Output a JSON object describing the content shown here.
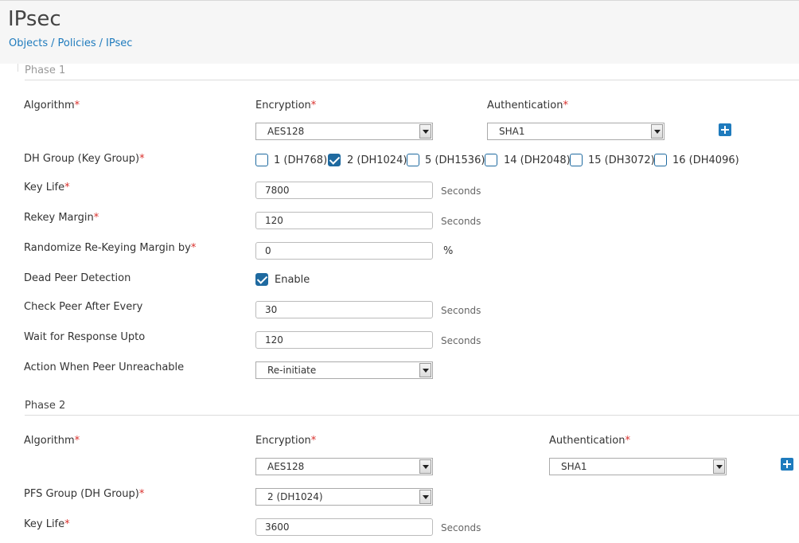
{
  "header": {
    "title": "IPsec",
    "breadcrumb": [
      "Objects",
      "Policies",
      "IPsec"
    ]
  },
  "phase1": {
    "title": "Phase 1",
    "algorithm_label": "Algorithm",
    "encryption_label": "Encryption",
    "authentication_label": "Authentication",
    "encryption_value": "AES128",
    "authentication_value": "SHA1",
    "dh_group_label": "DH Group (Key Group)",
    "dh_groups": [
      {
        "label": "1 (DH768)",
        "checked": false
      },
      {
        "label": "2 (DH1024)",
        "checked": true
      },
      {
        "label": "5 (DH1536)",
        "checked": false
      },
      {
        "label": "14 (DH2048)",
        "checked": false
      },
      {
        "label": "15 (DH3072)",
        "checked": false
      },
      {
        "label": "16 (DH4096)",
        "checked": false
      }
    ],
    "key_life_label": "Key Life",
    "key_life_value": "7800",
    "rekey_margin_label": "Rekey Margin",
    "rekey_margin_value": "120",
    "randomize_label": "Randomize Re-Keying Margin by",
    "randomize_value": "0",
    "dpd_label": "Dead Peer Detection",
    "dpd_enable_label": "Enable",
    "dpd_enabled": true,
    "check_peer_label": "Check Peer After Every",
    "check_peer_value": "30",
    "wait_response_label": "Wait for Response Upto",
    "wait_response_value": "120",
    "action_label": "Action When Peer Unreachable",
    "action_value": "Re-initiate"
  },
  "phase2": {
    "title": "Phase 2",
    "algorithm_label": "Algorithm",
    "encryption_label": "Encryption",
    "authentication_label": "Authentication",
    "encryption_value": "AES128",
    "authentication_value": "SHA1",
    "pfs_label": "PFS Group (DH Group)",
    "pfs_value": "2 (DH1024)",
    "key_life_label": "Key Life",
    "key_life_value": "3600"
  },
  "units": {
    "seconds": "Seconds",
    "percent": "%"
  },
  "required_marker": "*",
  "colors": {
    "accent": "#1f7bbd",
    "required": "#d9302c",
    "checkbox": "#1f6aa0"
  }
}
